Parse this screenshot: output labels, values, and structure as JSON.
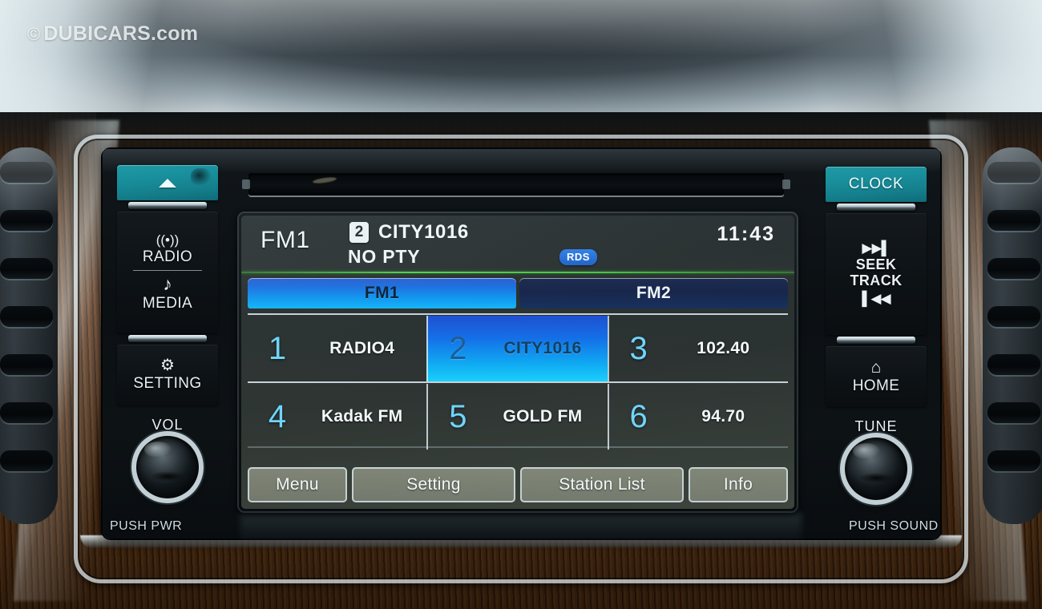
{
  "watermark": {
    "symbol": "©",
    "text": "DUBICARS.com"
  },
  "head_unit": {
    "left_controls": {
      "eject_label": "",
      "eject_icon": "eject-icon",
      "radio": {
        "icon": "radio-waves-icon",
        "icon_glyph": "((•))",
        "label": "RADIO"
      },
      "media": {
        "icon": "music-note-icon",
        "icon_glyph": "♪",
        "label": "MEDIA"
      },
      "setting": {
        "icon": "gear-icon",
        "icon_glyph": "✿",
        "label": "SETTING"
      },
      "volume_knob": {
        "label": "VOL",
        "push_label": "PUSH PWR"
      }
    },
    "right_controls": {
      "clock_button": "CLOCK",
      "seek": {
        "next_icon": "skip-forward-icon",
        "next_glyph": "▶▶|",
        "label_line1": "SEEK",
        "label_line2": "TRACK",
        "prev_icon": "skip-backward-icon",
        "prev_glyph": "|◀◀"
      },
      "home": {
        "icon": "home-icon",
        "icon_glyph": "⌂",
        "label": "HOME"
      },
      "tune_knob": {
        "label": "TUNE",
        "push_label": "PUSH SOUND"
      }
    }
  },
  "screen": {
    "header": {
      "band": "FM1",
      "preset_number": "2",
      "station_name": "CITY1016",
      "program_type": "NO PTY",
      "rds_badge": "RDS",
      "clock": "11:43"
    },
    "tabs": [
      {
        "label": "FM1",
        "active": true
      },
      {
        "label": "FM2",
        "active": false
      }
    ],
    "presets": [
      {
        "number": "1",
        "label": "RADIO4",
        "selected": false
      },
      {
        "number": "2",
        "label": "CITY1016",
        "selected": true
      },
      {
        "number": "3",
        "label": "102.40",
        "selected": false
      },
      {
        "number": "4",
        "label": "Kadak FM",
        "selected": false
      },
      {
        "number": "5",
        "label": "GOLD FM",
        "selected": false
      },
      {
        "number": "6",
        "label": "94.70",
        "selected": false
      }
    ],
    "softkeys": [
      {
        "label": "Menu"
      },
      {
        "label": "Setting"
      },
      {
        "label": "Station List"
      },
      {
        "label": "Info"
      }
    ]
  },
  "colors": {
    "teal_button": "#198f9c",
    "tab_active": "#14b5f7",
    "tab_idle": "#16244a",
    "preset_selected": "#1ad0fb",
    "preset_number": "#6fd4fb",
    "rds_blue": "#2f7fe8",
    "green_divider": "#4fd24a",
    "softkey_bg": "#787d6f",
    "screen_bg": "#2a3131"
  }
}
